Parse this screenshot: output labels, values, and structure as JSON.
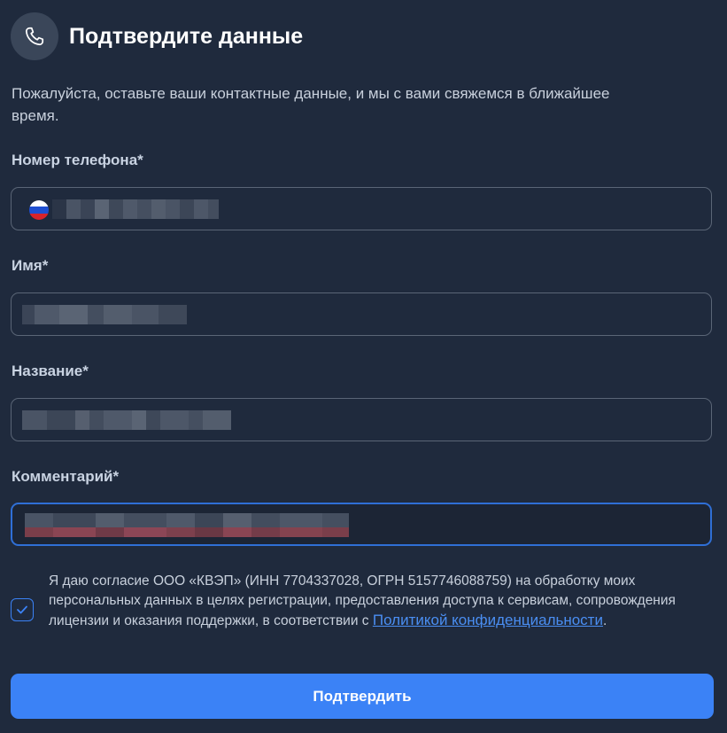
{
  "header": {
    "title": "Подтвердите данные",
    "icon": "phone-icon"
  },
  "description": "Пожалуйста, оставьте ваши контактные данные, и мы с вами свяжемся в ближайшее время.",
  "fields": {
    "phone": {
      "label": "Номер телефона*",
      "value": ""
    },
    "name": {
      "label": "Имя*",
      "value": ""
    },
    "company": {
      "label": "Название*",
      "value": ""
    },
    "comment": {
      "label": "Комментарий*",
      "value": ""
    }
  },
  "consent": {
    "checked": true,
    "text": "Я даю согласие ООО «КВЭП» (ИНН 7704337028, ОГРН 5157746088759) на обработку моих персональных данных в целях регистрации, предоставления доступа к сервисам, сопровождения лицензии и оказания поддержки, в соответствии с ",
    "link_text": "Политикой конфиденциальности",
    "suffix": "."
  },
  "submit_label": "Подтвердить",
  "colors": {
    "background": "#1f2a3d",
    "accent": "#3b82f6",
    "focus_border": "#2f6fd6"
  }
}
